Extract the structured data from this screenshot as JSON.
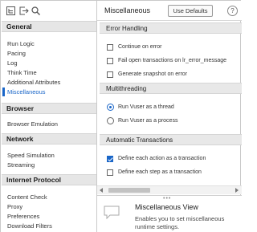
{
  "sidebar": {
    "toolbar_icons": [
      "expand-all-icon",
      "export-icon",
      "search-icon"
    ],
    "sections": [
      {
        "title": "General",
        "items": [
          "Run Logic",
          "Pacing",
          "Log",
          "Think Time",
          "Additional Attributes",
          "Miscellaneous"
        ]
      },
      {
        "title": "Browser",
        "items": [
          "Browser Emulation"
        ]
      },
      {
        "title": "Network",
        "items": [
          "Speed Simulation",
          "Streaming"
        ]
      },
      {
        "title": "Internet Protocol",
        "items": [
          "Content Check",
          "Proxy",
          "Preferences",
          "Download Filters"
        ]
      }
    ],
    "active_item": "Miscellaneous"
  },
  "header": {
    "title": "Miscellaneous",
    "use_defaults_label": "Use Defaults",
    "help_label": "?"
  },
  "groups": {
    "error_handling": {
      "title": "Error Handling",
      "options": [
        {
          "label": "Continue on error",
          "checked": false
        },
        {
          "label": "Fail open transactions on lr_error_message",
          "checked": false
        },
        {
          "label": "Generate snapshot on error",
          "checked": false
        }
      ]
    },
    "multithreading": {
      "title": "Multithreading",
      "options": [
        {
          "label": "Run Vuser as a thread",
          "selected": true
        },
        {
          "label": "Run Vuser as a process",
          "selected": false
        }
      ]
    },
    "automatic_transactions": {
      "title": "Automatic Transactions",
      "options": [
        {
          "label": "Define each action as a transaction",
          "checked": true
        },
        {
          "label": "Define each step as a transaction",
          "checked": false
        }
      ]
    }
  },
  "info_panel": {
    "grip": "•••",
    "title": "Miscellaneous View",
    "description": "Enables you to set miscellaneous runtime settings."
  },
  "colors": {
    "accent": "#1a66c8",
    "section_header_bg": "#e6e6e6",
    "border": "#c9c9c9"
  }
}
